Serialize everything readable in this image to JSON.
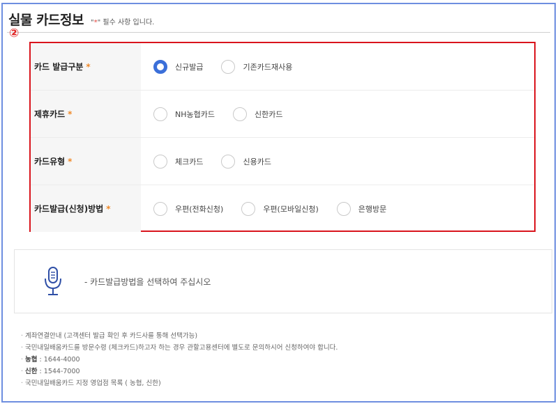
{
  "header": {
    "title": "실물 카드정보",
    "note_prefix": "\"",
    "note_asterisk": "*",
    "note_suffix": "\" 필수 사항 입니다."
  },
  "step_badge": "②",
  "form": {
    "rows": [
      {
        "label": "카드 발급구분",
        "required_mark": "*",
        "options": [
          {
            "label": "신규발급",
            "checked": true
          },
          {
            "label": "기존카드재사용",
            "checked": false
          }
        ]
      },
      {
        "label": "제휴카드",
        "required_mark": "*",
        "options": [
          {
            "label": "NH농협카드",
            "checked": false
          },
          {
            "label": "신한카드",
            "checked": false
          }
        ]
      },
      {
        "label": "카드유형",
        "required_mark": "*",
        "options": [
          {
            "label": "체크카드",
            "checked": false
          },
          {
            "label": "신용카드",
            "checked": false
          }
        ]
      },
      {
        "label": "카드발급(신청)방법",
        "required_mark": "*",
        "options": [
          {
            "label": "우편(전화신청)",
            "checked": false
          },
          {
            "label": "우편(모바일신청)",
            "checked": false
          },
          {
            "label": "은행방문",
            "checked": false
          }
        ]
      }
    ]
  },
  "voice": {
    "icon": "microphone-icon",
    "message": "- 카드발급방법을 선택하여 주십시오"
  },
  "notes": {
    "line1": "계좌연결안내 (고객센터 발급 확인 후 카드사를 통해 선택가능)",
    "line2": "국민내일배움카드를 방문수령 (체크카드)하고자 하는 경우 관할고용센터에 별도로 문의하시어 신청하여야 합니다.",
    "nh_label": "농협",
    "nh_phone": " : 1644-4000",
    "sh_label": "신한",
    "sh_phone": " : 1544-7000",
    "line5": "국민내일배움카드 지정 영업점 목록 ( 농협, 신한)"
  },
  "colors": {
    "frame_border": "#6d8ee0",
    "highlight_border": "#d9141c",
    "radio_checked": "#3b6fd9",
    "required": "#f08a2a"
  }
}
